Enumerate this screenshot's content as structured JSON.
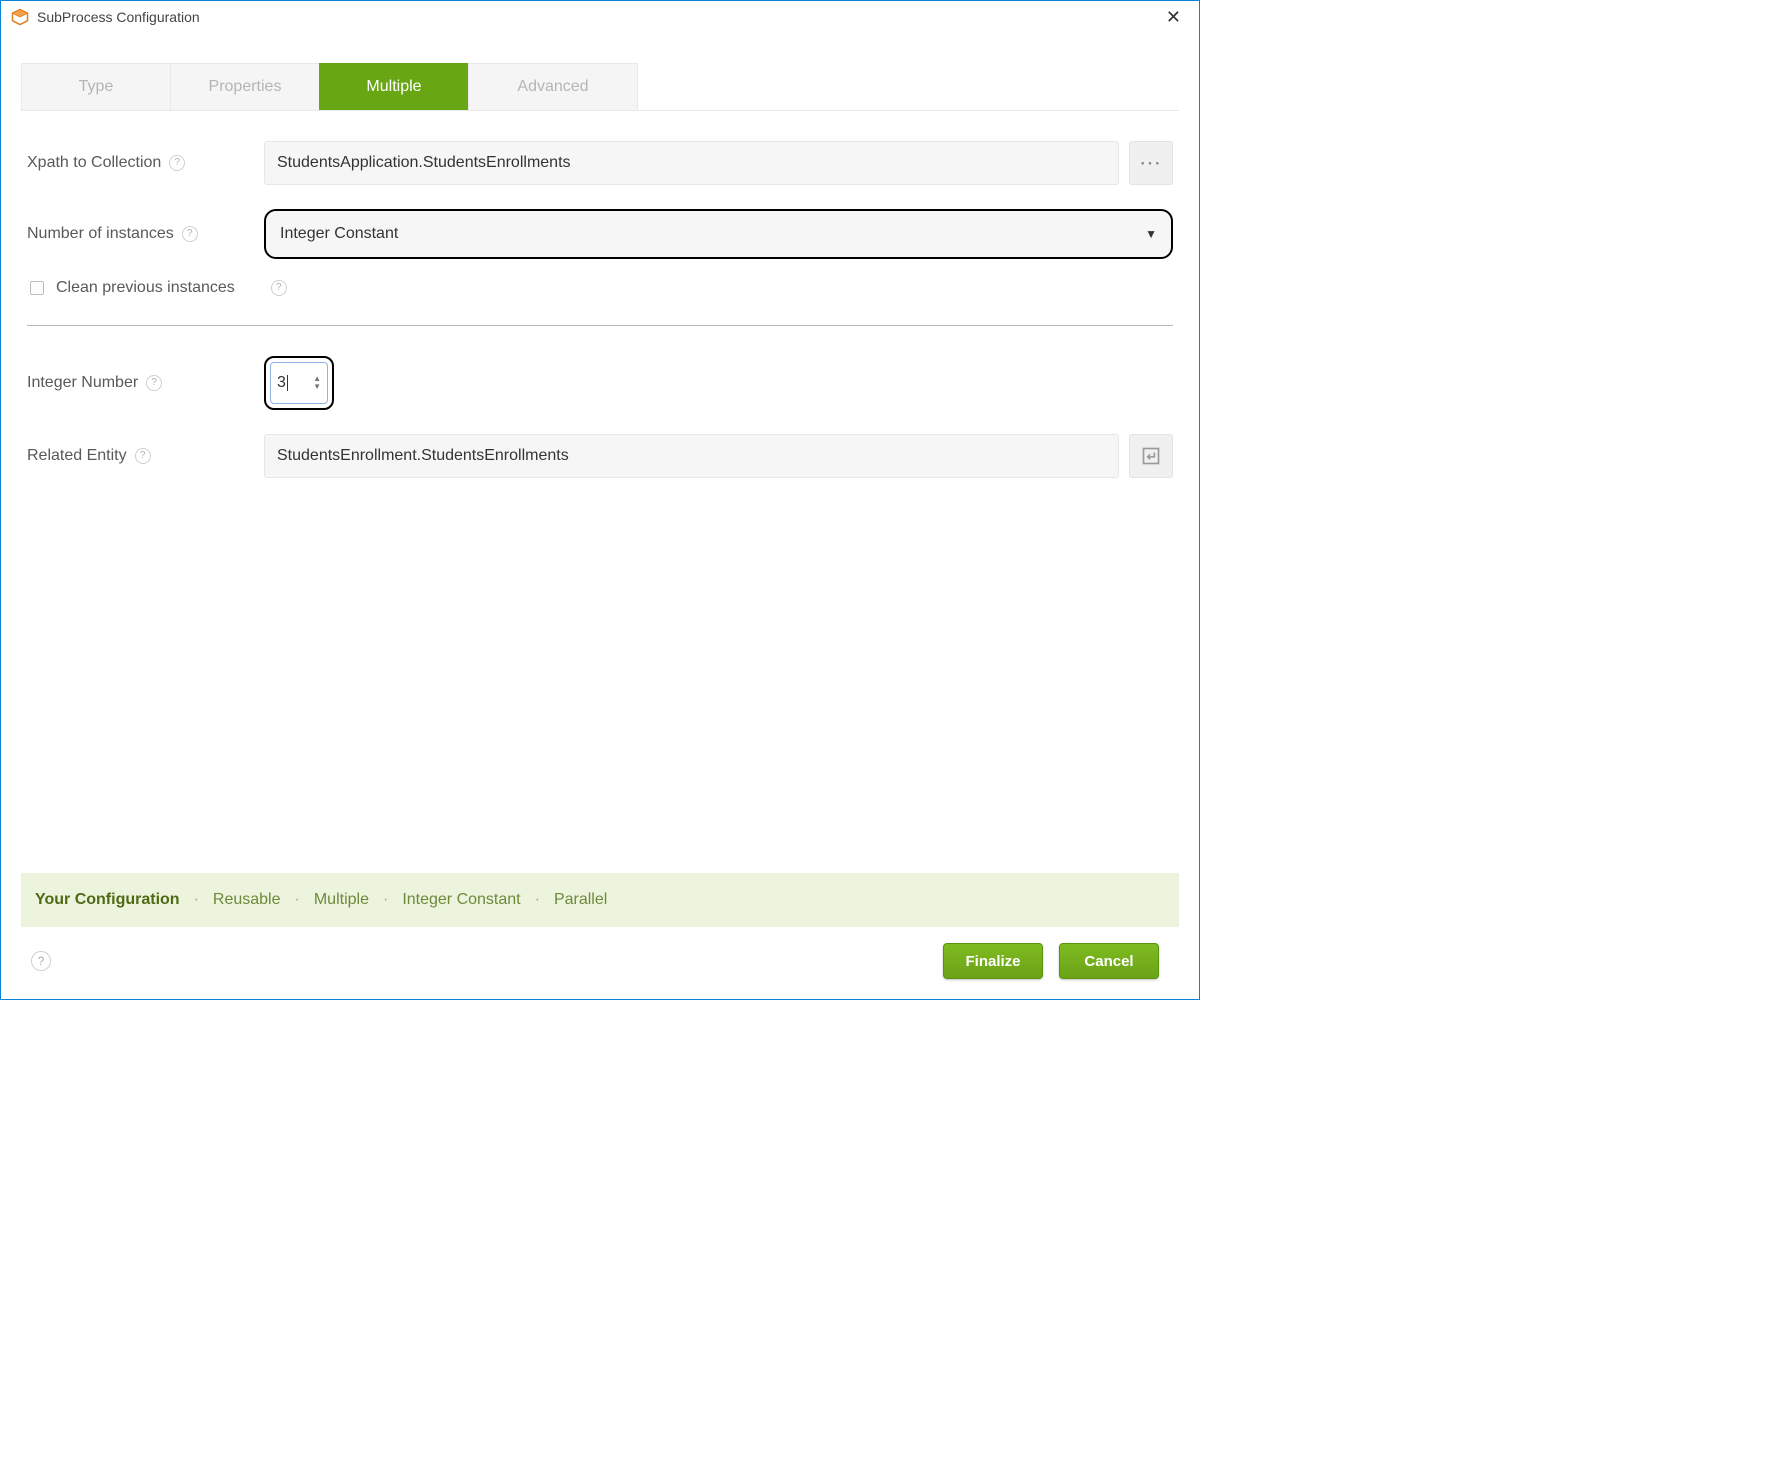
{
  "window": {
    "title": "SubProcess Configuration"
  },
  "tabs": [
    {
      "label": "Type"
    },
    {
      "label": "Properties"
    },
    {
      "label": "Multiple",
      "active": true
    },
    {
      "label": "Advanced"
    }
  ],
  "form": {
    "xpath_label": "Xpath to Collection",
    "xpath_value": "StudentsApplication.StudentsEnrollments",
    "instances_label": "Number of instances",
    "instances_value": "Integer Constant",
    "clean_label": "Clean previous instances",
    "clean_checked": false,
    "int_label": "Integer Number",
    "int_value": "3",
    "entity_label": "Related Entity",
    "entity_value": "StudentsEnrollment.StudentsEnrollments"
  },
  "config_bar": {
    "title": "Your Configuration",
    "items": [
      "Reusable",
      "Multiple",
      "Integer Constant",
      "Parallel"
    ]
  },
  "buttons": {
    "finalize": "Finalize",
    "cancel": "Cancel"
  }
}
